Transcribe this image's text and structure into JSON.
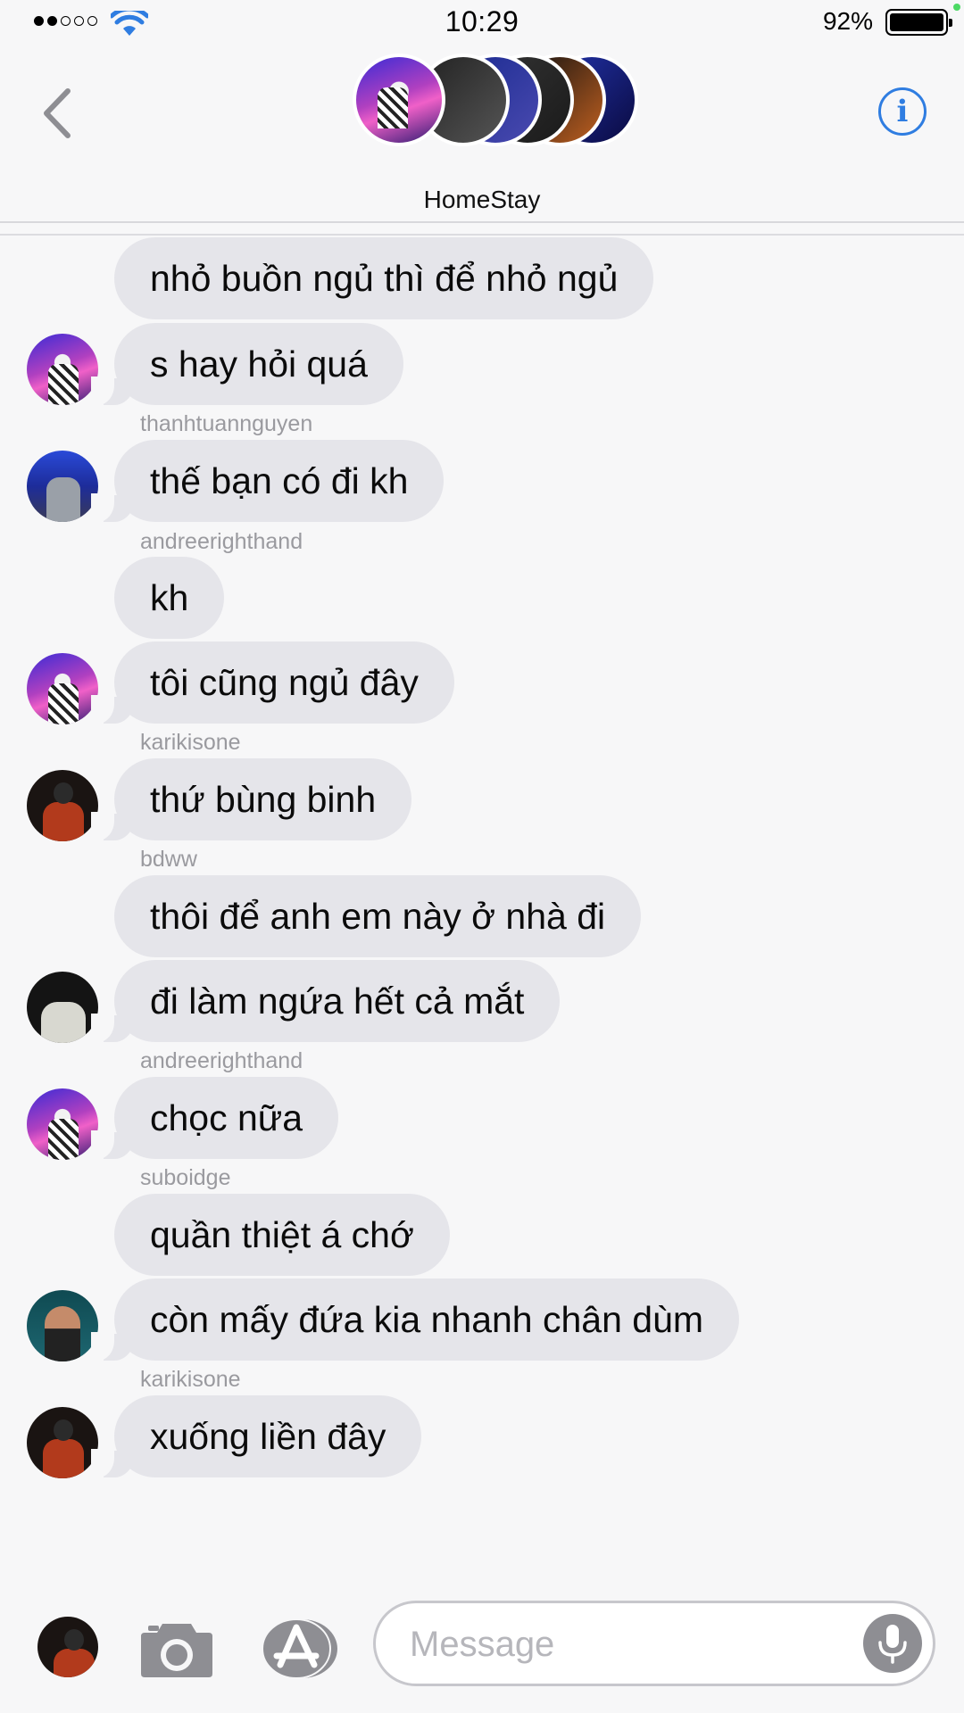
{
  "status_bar": {
    "time": "10:29",
    "battery_pct": "92%"
  },
  "header": {
    "group_name": "HomeStay"
  },
  "messages": [
    {
      "text": "nhỏ buồn ngủ thì để nhỏ ngủ"
    },
    {
      "text": "s hay hỏi quá"
    },
    {
      "sender": "thanhtuannguyen",
      "text": "thế bạn có đi kh"
    },
    {
      "sender": "andreerighthand",
      "text": "kh"
    },
    {
      "text": "tôi cũng ngủ đây"
    },
    {
      "sender": "karikisone",
      "text": "thứ bùng binh"
    },
    {
      "sender": "bdww",
      "text": "thôi để anh em này ở nhà đi"
    },
    {
      "text": "đi làm ngứa hết cả mắt"
    },
    {
      "sender": "andreerighthand",
      "text": "chọc nữa"
    },
    {
      "sender": "suboidge",
      "text": "quần thiệt á chớ"
    },
    {
      "text": "còn mấy đứa kia nhanh chân dùm"
    },
    {
      "sender": "karikisone",
      "text": "xuống liền đây"
    }
  ],
  "input": {
    "placeholder": "Message"
  }
}
